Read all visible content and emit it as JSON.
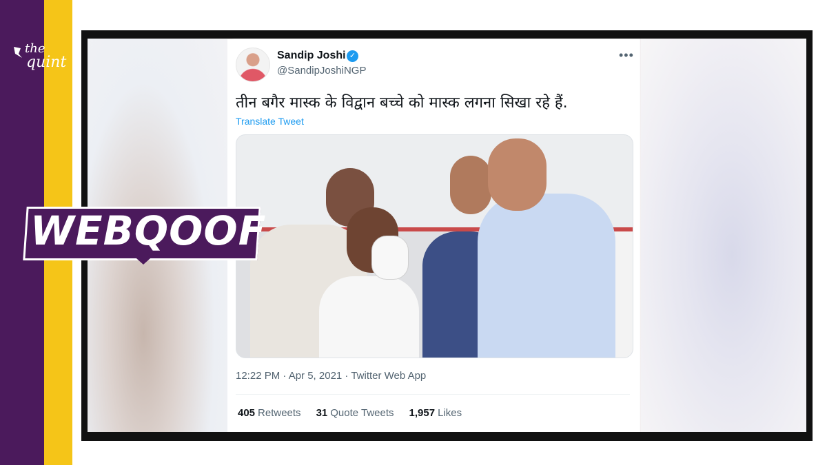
{
  "brand": {
    "logo_the": "the",
    "logo_quint": "quint",
    "purple": "#4b1a5c",
    "yellow": "#f5c518"
  },
  "badge": {
    "label": "WEBQOOF"
  },
  "tweet": {
    "author_name": "Sandip Joshi",
    "verified_icon": "verified-check-icon",
    "handle": "@SandipJoshiNGP",
    "more_icon": "more-options-icon",
    "text": "तीन बगैर मास्क के विद्वान बच्चे को मास्क लगना सिखा रहे हैं.",
    "translate_label": "Translate Tweet",
    "timestamp": "12:22 PM · Apr 5, 2021 · Twitter Web App",
    "stats": {
      "retweets_count": "405",
      "retweets_label": "Retweets",
      "quote_count": "31",
      "quote_label": "Quote Tweets",
      "likes_count": "1,957",
      "likes_label": "Likes"
    }
  }
}
